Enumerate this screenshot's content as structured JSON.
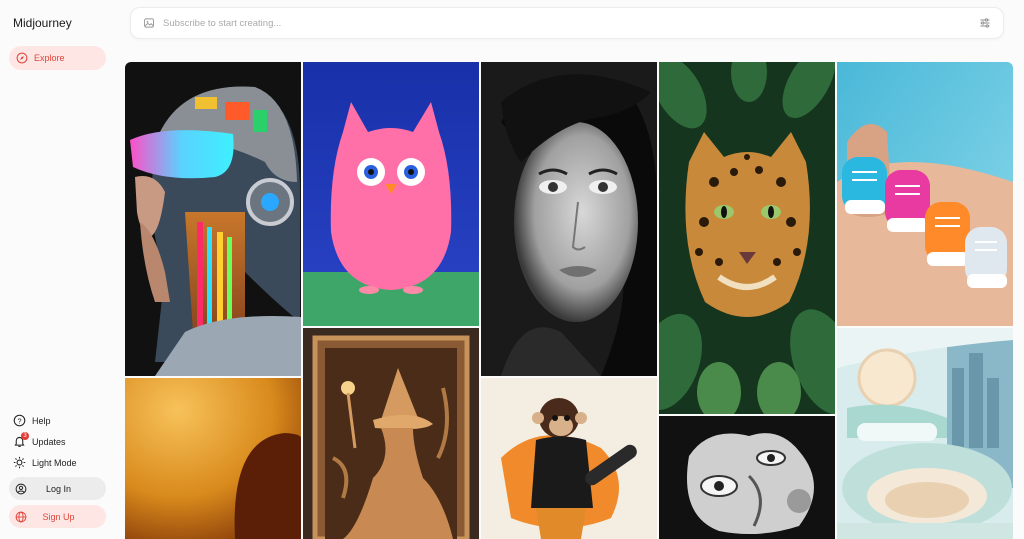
{
  "app": {
    "title": "Midjourney"
  },
  "sidebar": {
    "explore": "Explore",
    "help": "Help",
    "updates": "Updates",
    "updates_count": "3",
    "light_mode": "Light Mode",
    "login": "Log In",
    "signup": "Sign Up"
  },
  "search": {
    "placeholder": "Subscribe to start creating..."
  },
  "colors": {
    "accent": "#e0463b",
    "accent_bg": "#fde6e4"
  },
  "gallery": {
    "images": [
      {
        "id": "robot-woman-helmet",
        "desc": "chrome cyborg woman with neon visor"
      },
      {
        "id": "pink-fluffy-owl",
        "desc": "fluffy pink owl on blue background"
      },
      {
        "id": "bw-woman-portrait",
        "desc": "black and white portrait with freckles"
      },
      {
        "id": "leopard-in-leaves",
        "desc": "leopard face among green leaves"
      },
      {
        "id": "sneaker-nails",
        "desc": "nails painted like sneakers"
      },
      {
        "id": "orange-abstract",
        "desc": "warm orange abstract"
      },
      {
        "id": "carved-wood-witch",
        "desc": "carved wooden witch panel"
      },
      {
        "id": "monkey-skateboard",
        "desc": "monkey in hoodie with skateboard"
      },
      {
        "id": "eye-sculpture",
        "desc": "black and white eye sculpture collage"
      },
      {
        "id": "bedroom-interior",
        "desc": "pastel futuristic bedroom interior"
      }
    ]
  }
}
